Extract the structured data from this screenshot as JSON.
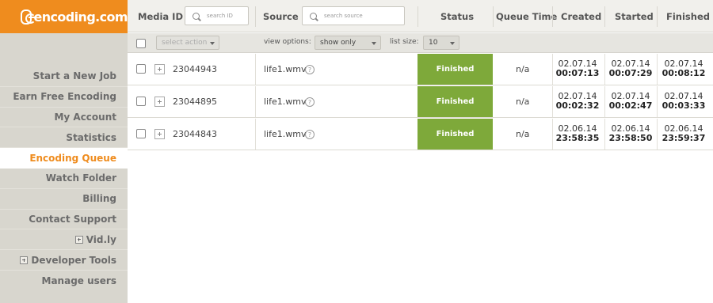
{
  "app": {
    "logo_text": "encoding.com"
  },
  "sidebar": {
    "items": [
      {
        "label": "Start a New Job"
      },
      {
        "label": "Earn Free Encoding"
      },
      {
        "label": "My Account"
      },
      {
        "label": "Statistics"
      },
      {
        "label": "Encoding Queue",
        "active": true
      },
      {
        "label": "Watch Folder"
      },
      {
        "label": "Billing"
      },
      {
        "label": "Contact Support"
      },
      {
        "label": "Vid.ly",
        "expandable": true
      },
      {
        "label": "Developer Tools",
        "expandable": true
      },
      {
        "label": "Manage users"
      }
    ]
  },
  "header": {
    "media_id": "Media ID",
    "media_id_placeholder": "search ID",
    "source": "Source",
    "source_placeholder": "search source",
    "status": "Status",
    "queue_time": "Queue Time",
    "created": "Created",
    "started": "Started",
    "finished": "Finished"
  },
  "toolbar": {
    "select_action": "select action",
    "view_options_label": "view options:",
    "view_options_value": "show only",
    "list_size_label": "list size:",
    "list_size_value": "10"
  },
  "rows": [
    {
      "id": "23044943",
      "source": "life1.wmv",
      "status": "Finished",
      "queue_time": "n/a",
      "created_date": "02.07.14",
      "created_time": "00:07:13",
      "started_date": "02.07.14",
      "started_time": "00:07:29",
      "finished_date": "02.07.14",
      "finished_time": "00:08:12"
    },
    {
      "id": "23044895",
      "source": "life1.wmv",
      "status": "Finished",
      "queue_time": "n/a",
      "created_date": "02.07.14",
      "created_time": "00:02:32",
      "started_date": "02.07.14",
      "started_time": "00:02:47",
      "finished_date": "02.07.14",
      "finished_time": "00:03:33"
    },
    {
      "id": "23044843",
      "source": "life1.wmv",
      "status": "Finished",
      "queue_time": "n/a",
      "created_date": "02.06.14",
      "created_time": "23:58:35",
      "started_date": "02.06.14",
      "started_time": "23:58:50",
      "finished_date": "02.06.14",
      "finished_time": "23:59:37"
    }
  ],
  "colors": {
    "brand": "#ef8c1e",
    "status_finished": "#7ea93a",
    "sidebar_bg": "#d8d6ce"
  },
  "icons": {
    "help": "?"
  }
}
